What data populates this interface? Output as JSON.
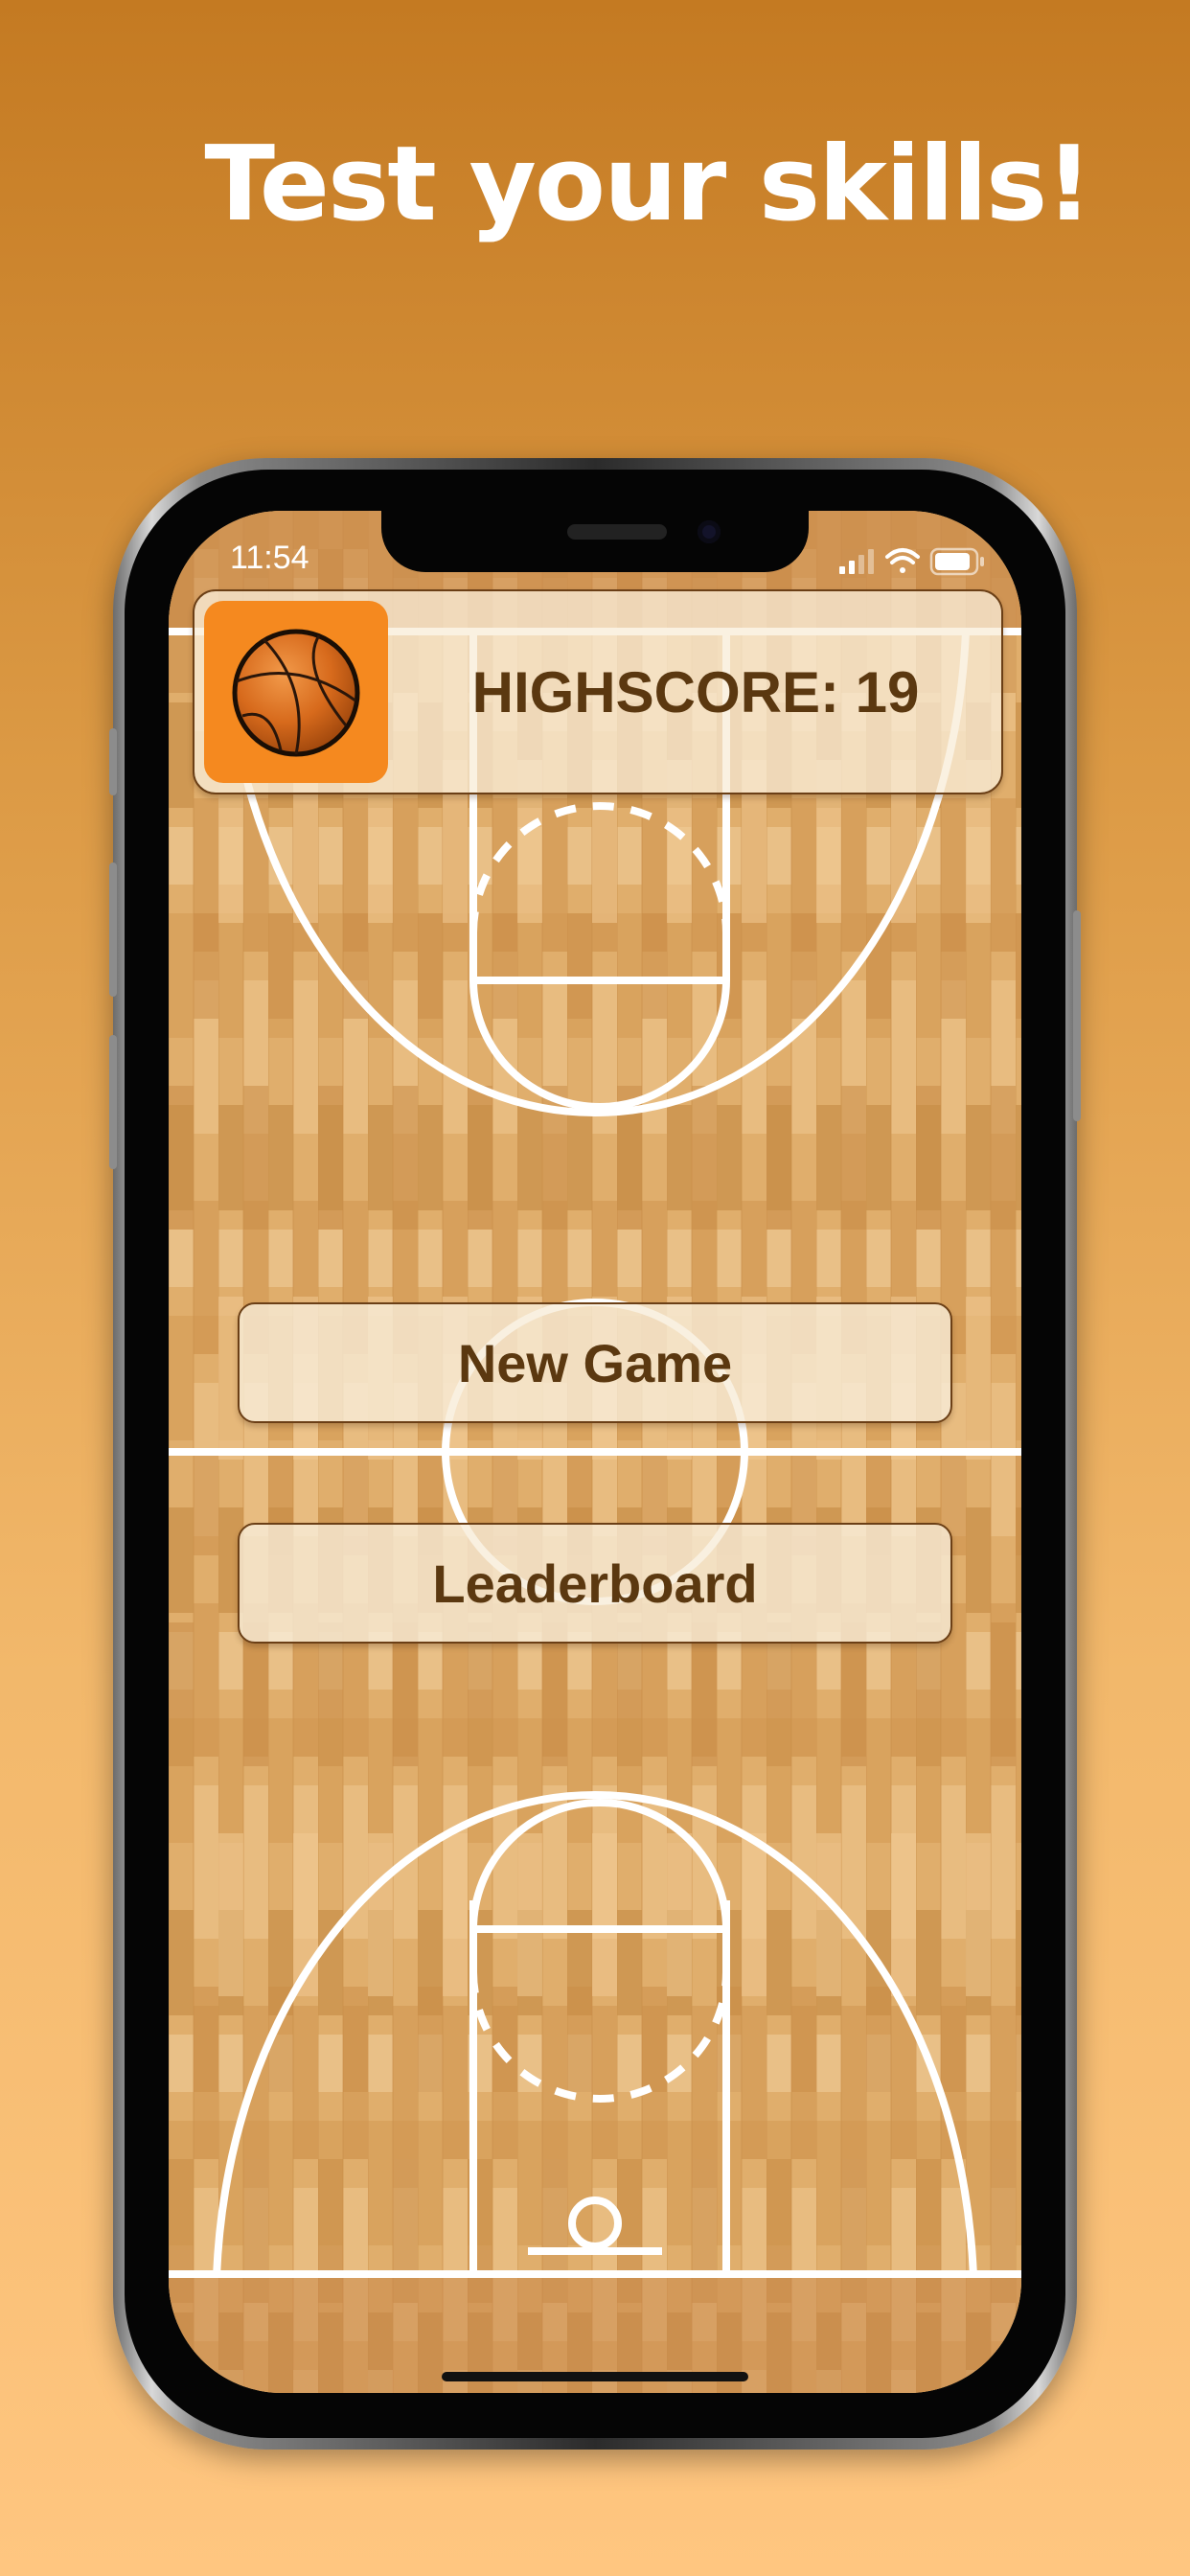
{
  "promo": {
    "headline": "Test your skills!"
  },
  "status_bar": {
    "time": "11:54",
    "icons": [
      "signal-icon",
      "wifi-icon",
      "battery-icon"
    ]
  },
  "highscore": {
    "label": "HIGHSCORE: 19",
    "icon": "basketball-icon"
  },
  "menu": {
    "new_game": "New Game",
    "leaderboard": "Leaderboard"
  },
  "colors": {
    "background_top": "#c47a22",
    "background_bottom": "#ffc680",
    "wood": "#e1b070",
    "court_lines": "#ffffff",
    "text_brown": "#5b3810",
    "ball_tile": "#f5891f"
  }
}
